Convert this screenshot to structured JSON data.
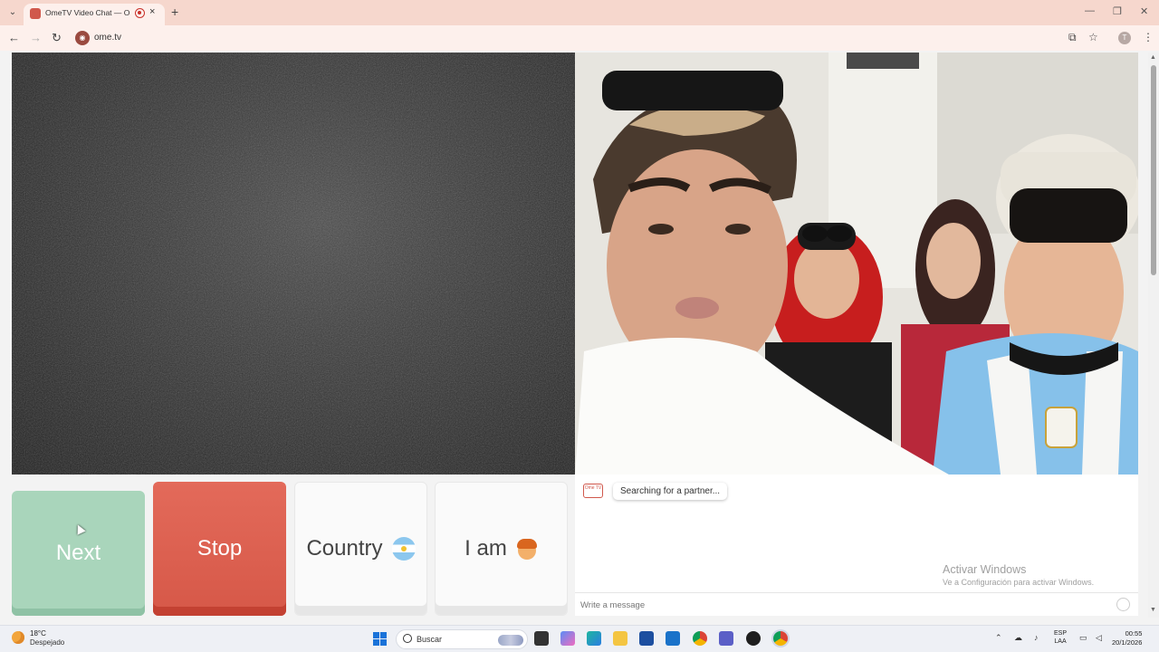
{
  "browser": {
    "tab_title": "OmeTV Video Chat — Ome",
    "url": "ome.tv",
    "new_tab": "+",
    "close": "×",
    "profile_initial": "T",
    "window_controls": [
      "—",
      "❐",
      "✕"
    ],
    "nav": {
      "back": "←",
      "forward": "→",
      "reload": "↻"
    },
    "icons": [
      "install-icon",
      "star-icon",
      "menu-icon"
    ]
  },
  "app": {
    "buttons": {
      "next": "Next",
      "stop": "Stop",
      "country": "Country",
      "iam": "I am"
    },
    "chat": {
      "logo": "Ome TV",
      "status_message": "Searching for a partner...",
      "input_placeholder": "Write a message"
    },
    "watermark": {
      "title": "Activar Windows",
      "subtitle": "Ve a Configuración para activar Windows."
    },
    "colors": {
      "next": "#a9d5bb",
      "stop": "#d65848"
    }
  },
  "taskbar": {
    "weather_temp": "18°C",
    "weather_desc": "Despejado",
    "search_placeholder": "Buscar",
    "lang_top": "ESP",
    "lang_bottom": "LAA",
    "time": "00:55",
    "date": "20/1/2026"
  }
}
